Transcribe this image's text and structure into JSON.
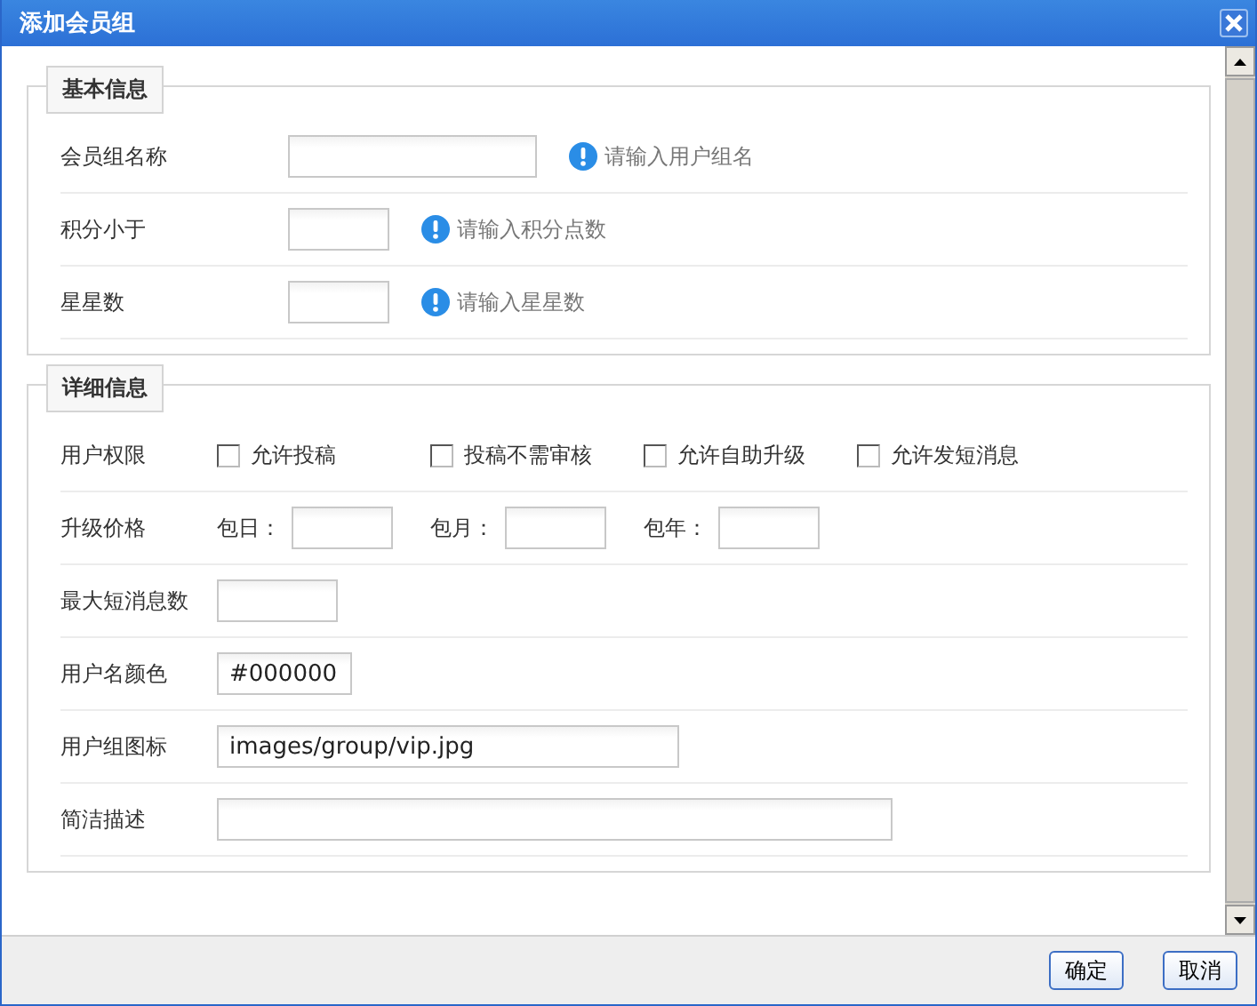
{
  "window": {
    "title": "添加会员组"
  },
  "basic_info": {
    "legend": "基本信息",
    "rows": [
      {
        "label": "会员组名称",
        "hint": "请输入用户组名"
      },
      {
        "label": "积分小于",
        "hint": "请输入积分点数"
      },
      {
        "label": "星星数",
        "hint": "请输入星星数"
      }
    ]
  },
  "detail_info": {
    "legend": "详细信息",
    "rows": [
      {
        "kind": "checkboxes",
        "label": "用户权限",
        "options": [
          {
            "label": "允许投稿",
            "checked": false
          },
          {
            "label": "投稿不需审核",
            "checked": false
          },
          {
            "label": "允许自助升级",
            "checked": false
          },
          {
            "label": "允许发短消息",
            "checked": false
          }
        ]
      },
      {
        "kind": "prices",
        "label": "升级价格",
        "fields": [
          {
            "label": "包日："
          },
          {
            "label": "包月："
          },
          {
            "label": "包年："
          }
        ]
      },
      {
        "kind": "field",
        "label": "最大短消息数"
      },
      {
        "kind": "field",
        "label": "用户名颜色",
        "value": "#000000"
      },
      {
        "kind": "field",
        "label": "用户组图标",
        "value": "images/group/vip.jpg"
      },
      {
        "kind": "field",
        "label": "简洁描述"
      }
    ]
  },
  "buttons": [
    "确定",
    "取消"
  ]
}
